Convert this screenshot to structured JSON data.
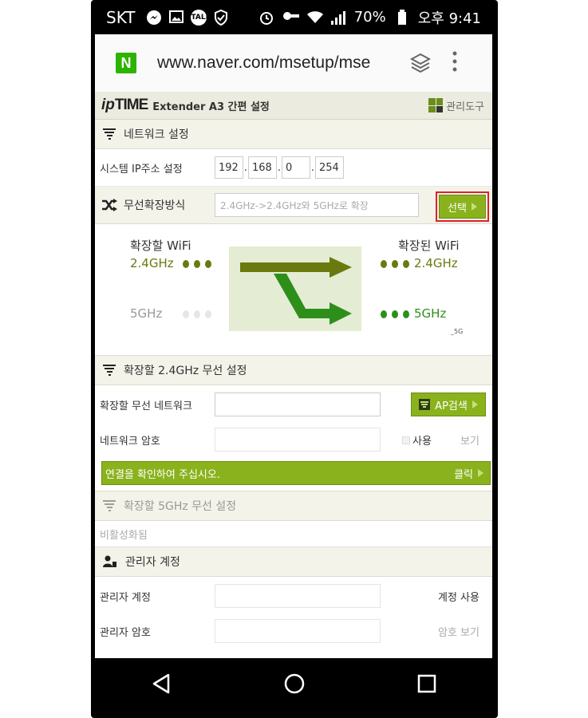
{
  "status_bar": {
    "carrier": "SKT",
    "talk_badge": "TALK",
    "battery": "70%",
    "time": "오후 9:41"
  },
  "browser": {
    "logo": "N",
    "url": "www.naver.com/msetup/mse"
  },
  "header": {
    "logo_ip": "ip",
    "logo_time": "TIME",
    "title": "Extender A3 간편 설정",
    "admin_tool": "관리도구"
  },
  "network": {
    "section_title": "네트워크 설정",
    "ip_label": "시스템 IP주소 설정",
    "ip": [
      "192",
      "168",
      "0",
      "254"
    ]
  },
  "wireless_mode": {
    "label": "무선확장방식",
    "value": "2.4GHz->2.4GHz와 5GHz로 확장",
    "select_button": "선택"
  },
  "diagram": {
    "left_title": "확장할 WiFi",
    "right_title": "확장된 WiFi",
    "left_24": "2.4GHz",
    "left_5": "5GHz",
    "right_24": "2.4GHz",
    "right_5": "5GHz",
    "suffix_5g": "_5G",
    "colors": {
      "olive": "#6b7a0f",
      "green": "#2d8f1a",
      "pale": "#e6e6e6",
      "panel": "#e4ecd3"
    }
  },
  "wireless24": {
    "section_title": "확장할 2.4GHz 무선 설정",
    "network_label": "확장할 무선 네트워크",
    "ap_button": "AP검색",
    "password_label": "네트워크 암호",
    "use_label": "사용",
    "show_label": "보기",
    "confirm_text": "연결을 확인하여 주십시오.",
    "click_label": "클릭"
  },
  "wireless5": {
    "section_title": "확장할 5GHz 무선 설정",
    "disabled_text": "비활성화됨"
  },
  "admin": {
    "section_title": "관리자 계정",
    "account_label": "관리자 계정",
    "account_use": "계정 사용",
    "password_label": "관리자 암호",
    "password_show": "암호 보기"
  },
  "accent_colors": {
    "green_button": "#8ab21d",
    "highlight_border": "#e0202a"
  }
}
